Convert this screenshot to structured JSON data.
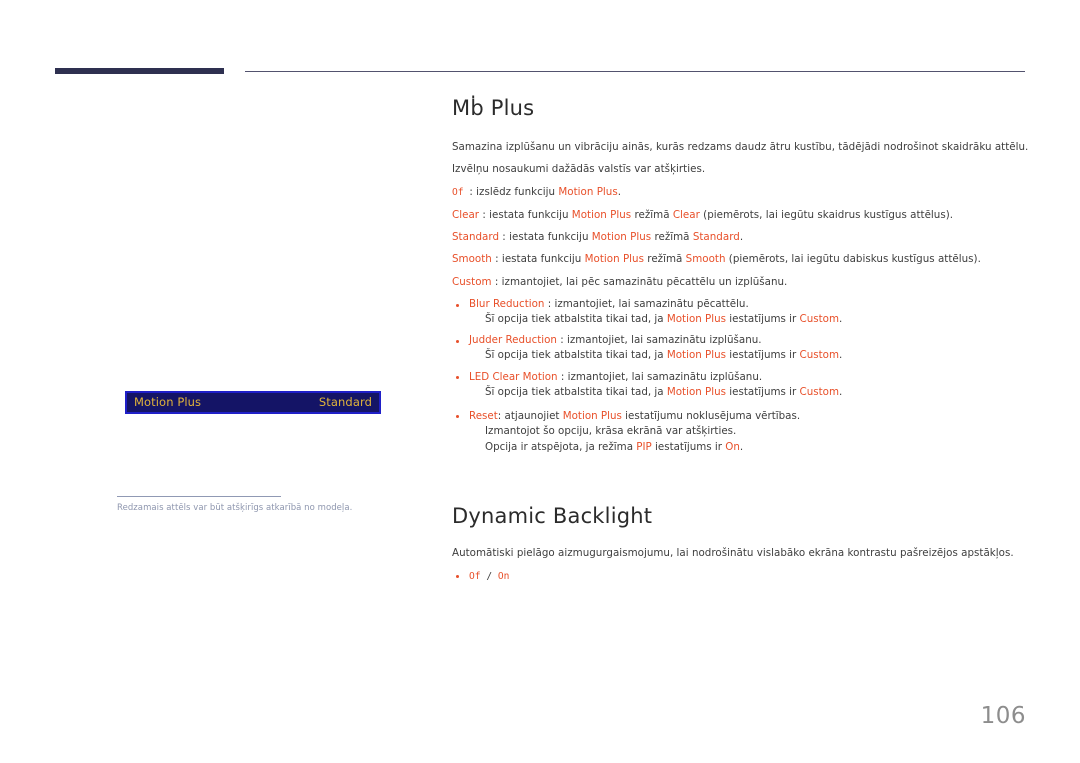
{
  "page": {
    "number": "106"
  },
  "left_panel": {
    "osd": {
      "label": "Motion Plus",
      "value": "Standard"
    },
    "caption": "Redzamais attēls var būt atšķirīgs atkarībā no modeļa."
  },
  "sections": [
    {
      "title": "Mḃ      Plus",
      "intro": [
        "Samazina izplūšanu un vibrāciju ainās, kurās redzams daudz ātru kustību, tādējādi nodrošinot skaidrāku attēlu.",
        "Izvēlņu nosaukumi dažādās valstīs var atšķirties."
      ],
      "options": [
        {
          "parts": [
            {
              "t": "Of ",
              "c": "opt-mono"
            },
            {
              "t": ": izslēdz funkciju ",
              "c": "plain"
            },
            {
              "t": "Motion Plus",
              "c": "opt"
            },
            {
              "t": ".",
              "c": "plain"
            }
          ]
        },
        {
          "parts": [
            {
              "t": "Clear",
              "c": "opt"
            },
            {
              "t": " : iestata funkciju ",
              "c": "plain"
            },
            {
              "t": "Motion Plus",
              "c": "opt"
            },
            {
              "t": " režīmā ",
              "c": "plain"
            },
            {
              "t": "Clear",
              "c": "opt"
            },
            {
              "t": " (piemērots, lai iegūtu skaidrus kustīgus attēlus).",
              "c": "plain"
            }
          ]
        },
        {
          "parts": [
            {
              "t": "Standard",
              "c": "opt"
            },
            {
              "t": " : iestata funkciju ",
              "c": "plain"
            },
            {
              "t": "Motion Plus",
              "c": "opt"
            },
            {
              "t": " režīmā ",
              "c": "plain"
            },
            {
              "t": "Standard",
              "c": "opt"
            },
            {
              "t": ".",
              "c": "plain"
            }
          ]
        },
        {
          "parts": [
            {
              "t": "Smooth",
              "c": "opt"
            },
            {
              "t": " : iestata funkciju ",
              "c": "plain"
            },
            {
              "t": "Motion Plus",
              "c": "opt"
            },
            {
              "t": " režīmā ",
              "c": "plain"
            },
            {
              "t": "Smooth",
              "c": "opt"
            },
            {
              "t": " (piemērots, lai iegūtu dabiskus kustīgus attēlus).",
              "c": "plain"
            }
          ]
        },
        {
          "parts": [
            {
              "t": "Custom",
              "c": "opt"
            },
            {
              "t": " : izmantojiet, lai pēc samazinātu pēcattēlu un izplūšanu.",
              "c": "plain"
            }
          ]
        }
      ],
      "bullets": [
        {
          "main": [
            {
              "t": "Blur Reduction",
              "c": "opt"
            },
            {
              "t": " : izmantojiet, lai samazinātu pēcattēlu.",
              "c": "plain"
            }
          ],
          "sub": [
            [
              {
                "t": "Šī opcija tiek atbalstita tikai tad, ja ",
                "c": "plain"
              },
              {
                "t": "Motion Plus",
                "c": "opt"
              },
              {
                "t": " iestatījums ir ",
                "c": "plain"
              },
              {
                "t": "Custom",
                "c": "opt"
              },
              {
                "t": ".",
                "c": "plain"
              }
            ]
          ]
        },
        {
          "main": [
            {
              "t": "Judder Reduction",
              "c": "opt"
            },
            {
              "t": " : izmantojiet, lai samazinātu izplūšanu.",
              "c": "plain"
            }
          ],
          "sub": [
            [
              {
                "t": "Šī opcija tiek atbalstita tikai tad, ja ",
                "c": "plain"
              },
              {
                "t": "Motion Plus",
                "c": "opt"
              },
              {
                "t": " iestatījums ir ",
                "c": "plain"
              },
              {
                "t": "Custom",
                "c": "opt"
              },
              {
                "t": ".",
                "c": "plain"
              }
            ]
          ]
        },
        {
          "main": [
            {
              "t": "LED Clear Motion",
              "c": "opt"
            },
            {
              "t": " : izmantojiet, lai samazinātu izplūšanu.",
              "c": "plain"
            }
          ],
          "sub": [
            [
              {
                "t": "Šī opcija tiek atbalstita tikai tad, ja ",
                "c": "plain"
              },
              {
                "t": "Motion Plus",
                "c": "opt"
              },
              {
                "t": " iestatījums ir ",
                "c": "plain"
              },
              {
                "t": "Custom",
                "c": "opt"
              },
              {
                "t": ".",
                "c": "plain"
              }
            ]
          ]
        },
        {
          "main": [
            {
              "t": "Reset",
              "c": "opt"
            },
            {
              "t": ": atjaunojiet ",
              "c": "plain"
            },
            {
              "t": "Motion Plus",
              "c": "opt"
            },
            {
              "t": " iestatījumu noklusējuma vērtības.",
              "c": "plain"
            }
          ],
          "sub": [
            [
              {
                "t": "Izmantojot šo opciju, krāsa ekrānā var atšķirties.",
                "c": "plain"
              }
            ],
            [
              {
                "t": "Opcija ir atspējota, ja režīma ",
                "c": "plain"
              },
              {
                "t": "PIP",
                "c": "opt"
              },
              {
                "t": " iestatījums ir ",
                "c": "plain"
              },
              {
                "t": "On",
                "c": "opt"
              },
              {
                "t": ".",
                "c": "plain"
              }
            ]
          ]
        }
      ]
    },
    {
      "title": "Dynamic Backlight",
      "intro": [
        "Automātiski pielāgo aizmugurgaismojumu, lai nodrošinātu vislabāko ekrāna kontrastu pašreizējos apstākļos."
      ],
      "bullets": [
        {
          "main": [
            {
              "t": "Of ",
              "c": "opt-mono"
            },
            {
              "t": "/ ",
              "c": "slash"
            },
            {
              "t": "On",
              "c": "opt-mono"
            }
          ],
          "sub": []
        }
      ]
    }
  ],
  "colors": {
    "accent_orange": "#e8502a",
    "osd_bg": "#141466",
    "osd_border": "#1f1fc8",
    "osd_text": "#e0b33a",
    "header_bar": "#2e3050",
    "page_number": "#8d8d8d"
  }
}
